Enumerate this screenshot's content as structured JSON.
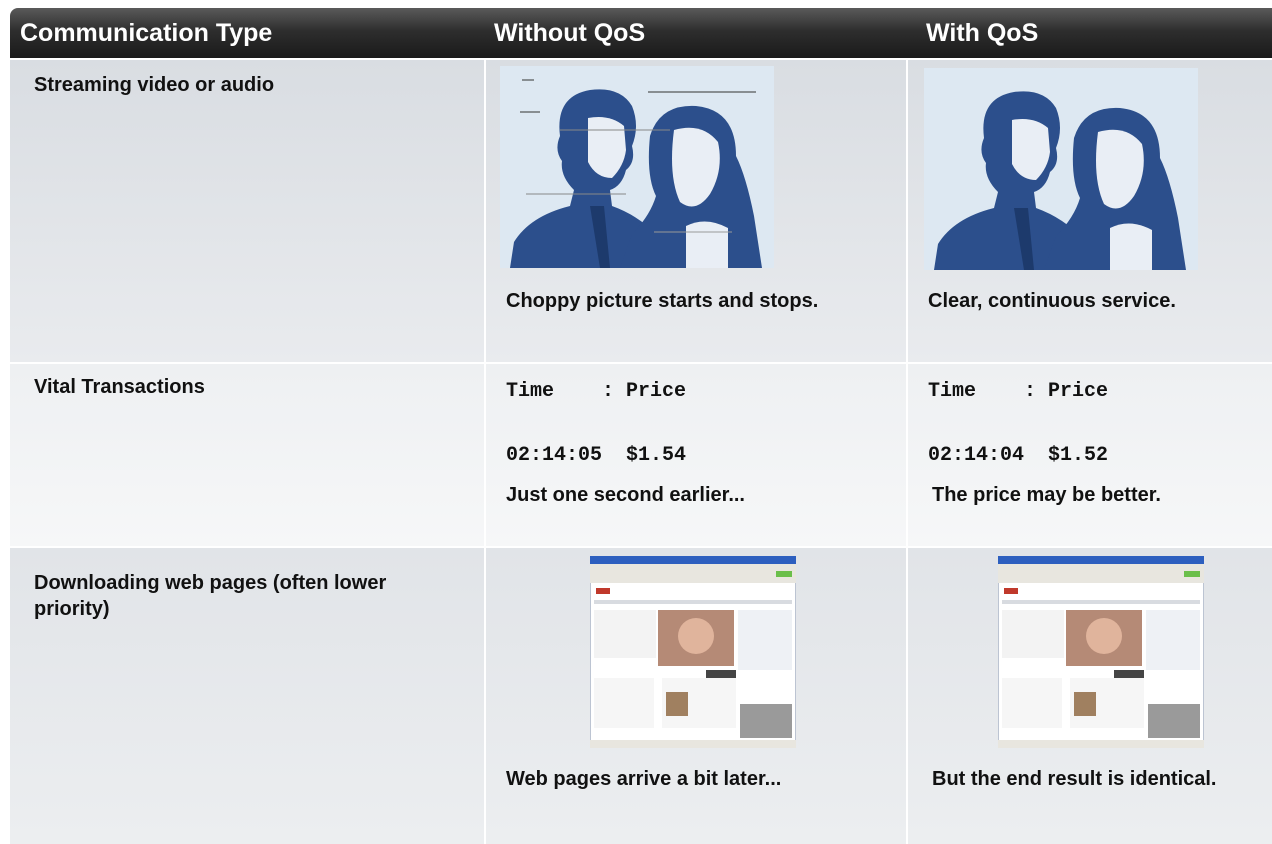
{
  "header": {
    "col1": "Communication Type",
    "col2": "Without QoS",
    "col3": "With QoS"
  },
  "rows": [
    {
      "type": "Streaming video or audio",
      "without_caption": "Choppy picture starts and stops.",
      "with_caption": "Clear, continuous service."
    },
    {
      "type": "Vital Transactions",
      "without_header": "Time    : Price",
      "without_value": "02:14:05  $1.54",
      "without_caption": "Just one second earlier...",
      "with_header": "Time    : Price",
      "with_value": "02:14:04  $1.52",
      "with_caption": "The price may be better."
    },
    {
      "type": "Downloading web pages (often lower priority)",
      "without_caption": "Web pages arrive a bit later...",
      "with_caption": "But the end result is identical."
    }
  ],
  "colors": {
    "header_bg": "#1a1a1a",
    "header_text": "#ffffff",
    "illustration_blue": "#2c4f8c",
    "illustration_bg": "#dde8f2"
  }
}
